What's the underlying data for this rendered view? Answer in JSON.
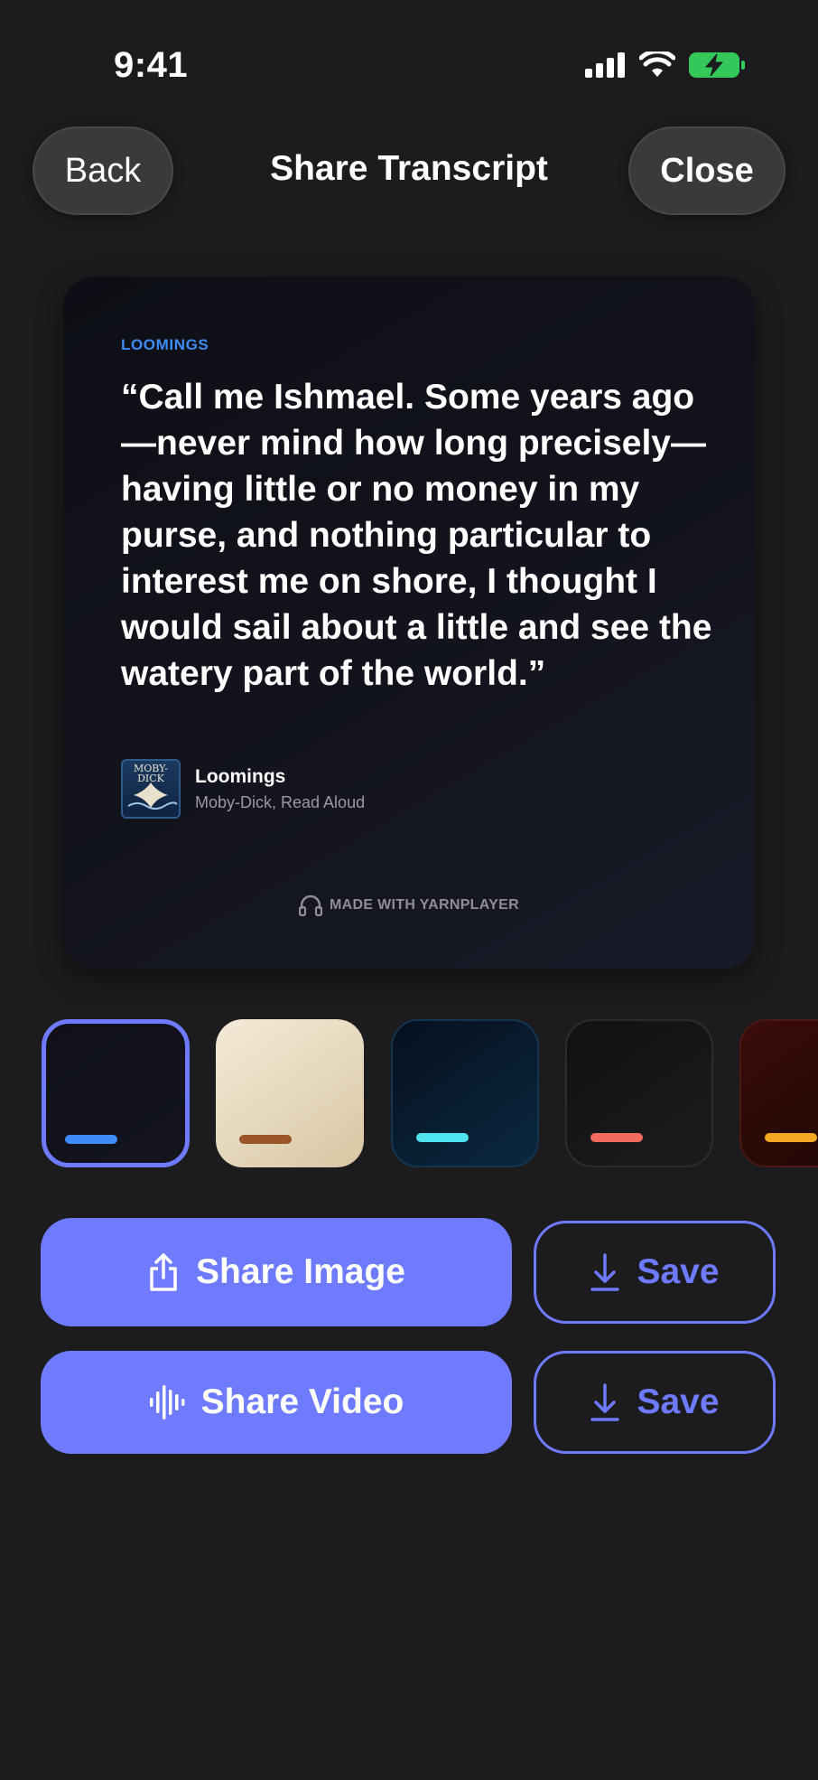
{
  "status_bar": {
    "time": "9:41"
  },
  "nav": {
    "back_label": "Back",
    "title": "Share Transcript",
    "close_label": "Close"
  },
  "card": {
    "chapter": "LOOMINGS",
    "quote": "“Call me Ishmael. Some years ago—never mind how long precisely—having little or no money in my purse, and nothing particular to interest me on shore, I thought I would sail about a little and see the watery part of the world.”",
    "episode_title": "Loomings",
    "episode_subtitle": "Moby-Dick, Read Aloud",
    "cover_text": "MOBY-DICK",
    "footer": "MADE WITH YARNPLAYER"
  },
  "themes": [
    {
      "name": "dark-blue",
      "accent": "#3d8cf7",
      "selected": true
    },
    {
      "name": "cream",
      "accent": "#9a5428",
      "selected": false
    },
    {
      "name": "navy-teal",
      "accent": "#4fe3ef",
      "selected": false
    },
    {
      "name": "charcoal-coral",
      "accent": "#f26a5e",
      "selected": false
    },
    {
      "name": "red-orange",
      "accent": "#f5a623",
      "selected": false
    }
  ],
  "actions": {
    "share_image_label": "Share Image",
    "share_video_label": "Share Video",
    "save_image_label": "Save",
    "save_video_label": "Save"
  },
  "colors": {
    "accent": "#6e7bff",
    "background": "#1c1c1e",
    "battery": "#34c759"
  }
}
